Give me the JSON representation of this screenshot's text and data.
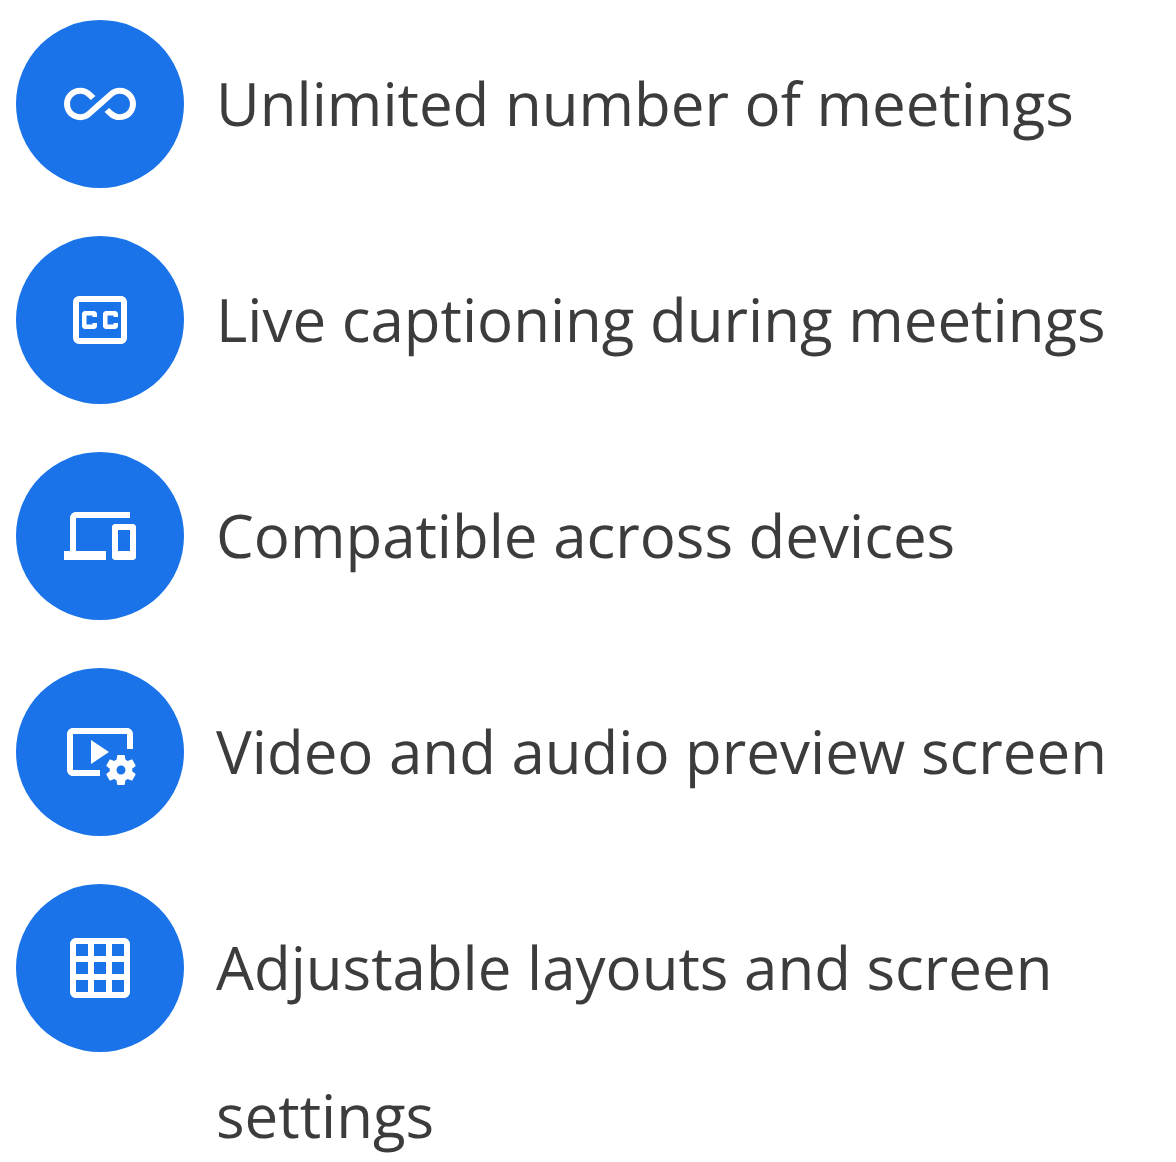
{
  "features": [
    {
      "kind": "infinity",
      "label": "Unlimited number of meetings"
    },
    {
      "kind": "captions",
      "label": "Live captioning during meetings"
    },
    {
      "kind": "devices",
      "label": "Compatible across devices"
    },
    {
      "kind": "video-settings",
      "label": "Video and audio preview screen"
    },
    {
      "kind": "grid",
      "label": "Adjustable layouts and screen settings"
    }
  ]
}
